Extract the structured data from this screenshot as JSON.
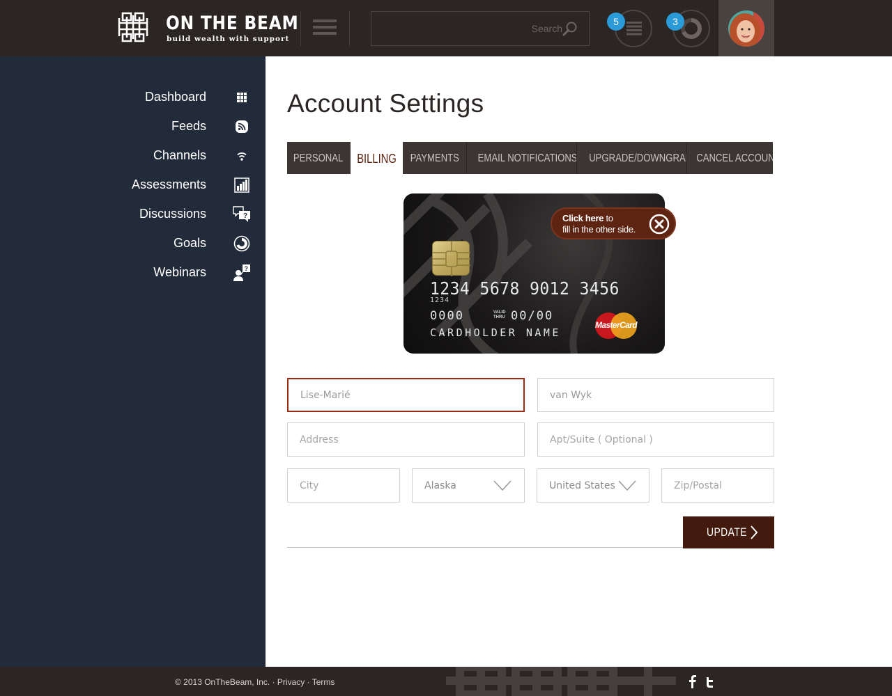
{
  "header": {
    "logo_title": "ON THE BEAM",
    "logo_tagline": "build wealth with support",
    "search_placeholder": "Search",
    "feed_badge": "5",
    "goals_badge": "3"
  },
  "sidebar": {
    "items": [
      {
        "label": "Dashboard",
        "icon": "grid-icon"
      },
      {
        "label": "Feeds",
        "icon": "rss-icon"
      },
      {
        "label": "Channels",
        "icon": "wifi-icon"
      },
      {
        "label": "Assessments",
        "icon": "bar-chart-icon"
      },
      {
        "label": "Discussions",
        "icon": "chat-question-icon"
      },
      {
        "label": "Goals",
        "icon": "goal-circle-icon"
      },
      {
        "label": "Webinars",
        "icon": "presenter-question-icon"
      }
    ]
  },
  "main": {
    "page_title": "Account Settings",
    "tabs": [
      {
        "label": "PERSONAL",
        "active": false
      },
      {
        "label": "BILLING",
        "active": true
      },
      {
        "label": "PAYMENTS",
        "active": false
      },
      {
        "label": "EMAIL NOTIFICATIONS",
        "active": false
      },
      {
        "label": "UPGRADE/DOWNGRADE",
        "active": false
      },
      {
        "label": "CANCEL ACCOUNT",
        "active": false
      }
    ]
  },
  "card": {
    "number": "1234 5678 9012 3456",
    "number_small": "1234",
    "cvv": "0000",
    "valid_thru_line1": "VALID",
    "valid_thru_line2": "THRU",
    "expiry": "00/00",
    "holder": "CARDHOLDER NAME",
    "brand": "MasterCard",
    "tip_bold": "Click here",
    "tip_rest_1": " to",
    "tip_rest_2": "fill in the other side."
  },
  "form": {
    "first_name": "Lise-Marié",
    "last_name": "van Wyk",
    "address_placeholder": "Address",
    "apt_placeholder": "Apt/Suite ( Optional )",
    "city_placeholder": "City",
    "state": "Alaska",
    "country": "United States",
    "zip_placeholder": "Zip/Postal",
    "update_label": "UPDATE"
  },
  "footer": {
    "copyright": "© 2013 OnTheBeam, Inc.",
    "sep": " · ",
    "privacy": "Privacy",
    "terms": "Terms"
  },
  "colors": {
    "header_bg": "#2b2523",
    "sidebar_bg": "#222b3a",
    "accent": "#431b0e",
    "focus_border": "#9a2c14",
    "badge": "#2a9ad9"
  }
}
